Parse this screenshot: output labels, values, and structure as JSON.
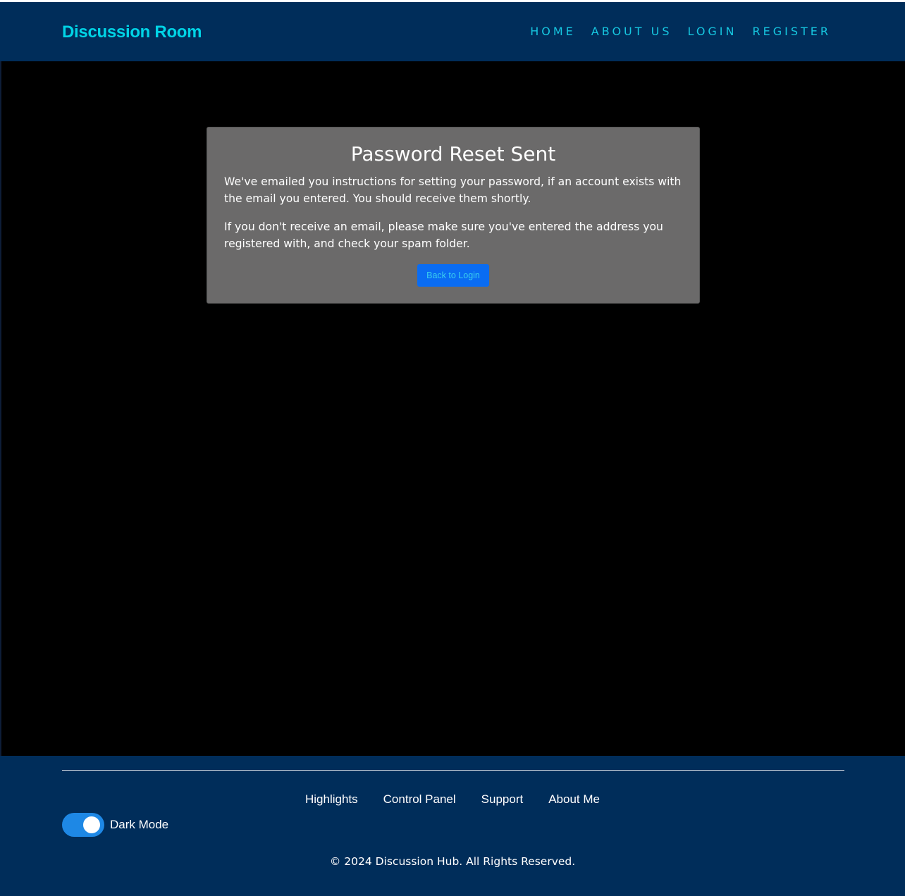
{
  "header": {
    "brand": "Discussion Room",
    "nav": [
      "HOME",
      "ABOUT US",
      "LOGIN",
      "REGISTER"
    ]
  },
  "card": {
    "title": "Password Reset Sent",
    "paragraph1": "We've emailed you instructions for setting your password, if an account exists with the email you entered. You should receive them shortly.",
    "paragraph2": "If you don't receive an email, please make sure you've entered the address you registered with, and check your spam folder.",
    "button_label": "Back to Login"
  },
  "footer": {
    "links": [
      "Highlights",
      "Control Panel",
      "Support",
      "About Me"
    ],
    "toggle_label": "Dark Mode",
    "toggle_on": true,
    "copyright": "© 2024 Discussion Hub. All Rights Reserved."
  },
  "colors": {
    "header_bg": "#002d5a",
    "brand": "#00d4e6",
    "nav": "#16c7e0",
    "card_bg": "#6b6a6a",
    "button_bg": "#0a6cf2",
    "toggle_bg": "#1e88e5"
  }
}
